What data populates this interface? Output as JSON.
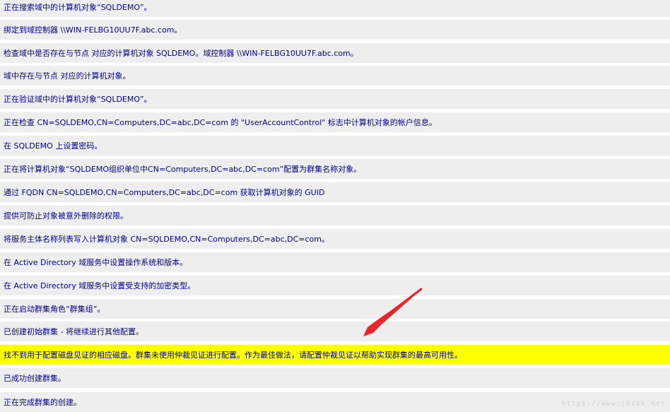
{
  "log": {
    "rows": [
      {
        "text": "正在搜索域中的计算机对象“SQLDEMO”。",
        "highlight": false
      },
      {
        "text": "绑定到域控制器 \\\\WIN-FELBG10UU7F.abc.com。",
        "highlight": false
      },
      {
        "text": "检查域中是否存在与节点 对应的计算机对象 SQLDEMO。域控制器 \\\\WIN-FELBG10UU7F.abc.com。",
        "highlight": false
      },
      {
        "text": "域中存在与节点 对应的计算机对象。",
        "highlight": false
      },
      {
        "text": "正在验证域中的计算机对象“SQLDEMO”。",
        "highlight": false
      },
      {
        "text": "正在检查 CN=SQLDEMO,CN=Computers,DC=abc,DC=com 的 \"UserAccountControl\" 标志中计算机对象的帐户信息。",
        "highlight": false
      },
      {
        "text": "在 SQLDEMO 上设置密码。",
        "highlight": false
      },
      {
        "text": "正在将计算机对象“SQLDEMO组织单位中CN=Computers,DC=abc,DC=com”配置为群集名称对象。",
        "highlight": false
      },
      {
        "text": "通过 FQDN CN=SQLDEMO,CN=Computers,DC=abc,DC=com 获取计算机对象的 GUID",
        "highlight": false
      },
      {
        "text": "提供可防止对象被意外删除的权限。",
        "highlight": false
      },
      {
        "text": "将服务主体名称列表写入计算机对象 CN=SQLDEMO,CN=Computers,DC=abc,DC=com。",
        "highlight": false
      },
      {
        "text": "在 Active Directory 域服务中设置操作系统和版本。",
        "highlight": false
      },
      {
        "text": "在 Active Directory 域服务中设置受支持的加密类型。",
        "highlight": false
      },
      {
        "text": "正在启动群集角色“群集组”。",
        "highlight": false
      },
      {
        "text": "已创建初始群集 - 将继续进行其他配置。",
        "highlight": false
      },
      {
        "text": "找不到用于配置磁盘见证的相应磁盘。群集未使用仲裁见证进行配置。作为最佳做法，请配置仲裁见证以帮助实现群集的最高可用性。",
        "highlight": true
      },
      {
        "text": "已成功创建群集。",
        "highlight": false
      },
      {
        "text": "正在完成群集的创建。",
        "highlight": false
      }
    ]
  },
  "colors": {
    "row_background": "#eeeeee",
    "highlight_background": "#ffff00",
    "text": "#00008b",
    "arrow": "#e8262a"
  },
  "watermark": {
    "text": "https://www.jbzxk.net"
  }
}
